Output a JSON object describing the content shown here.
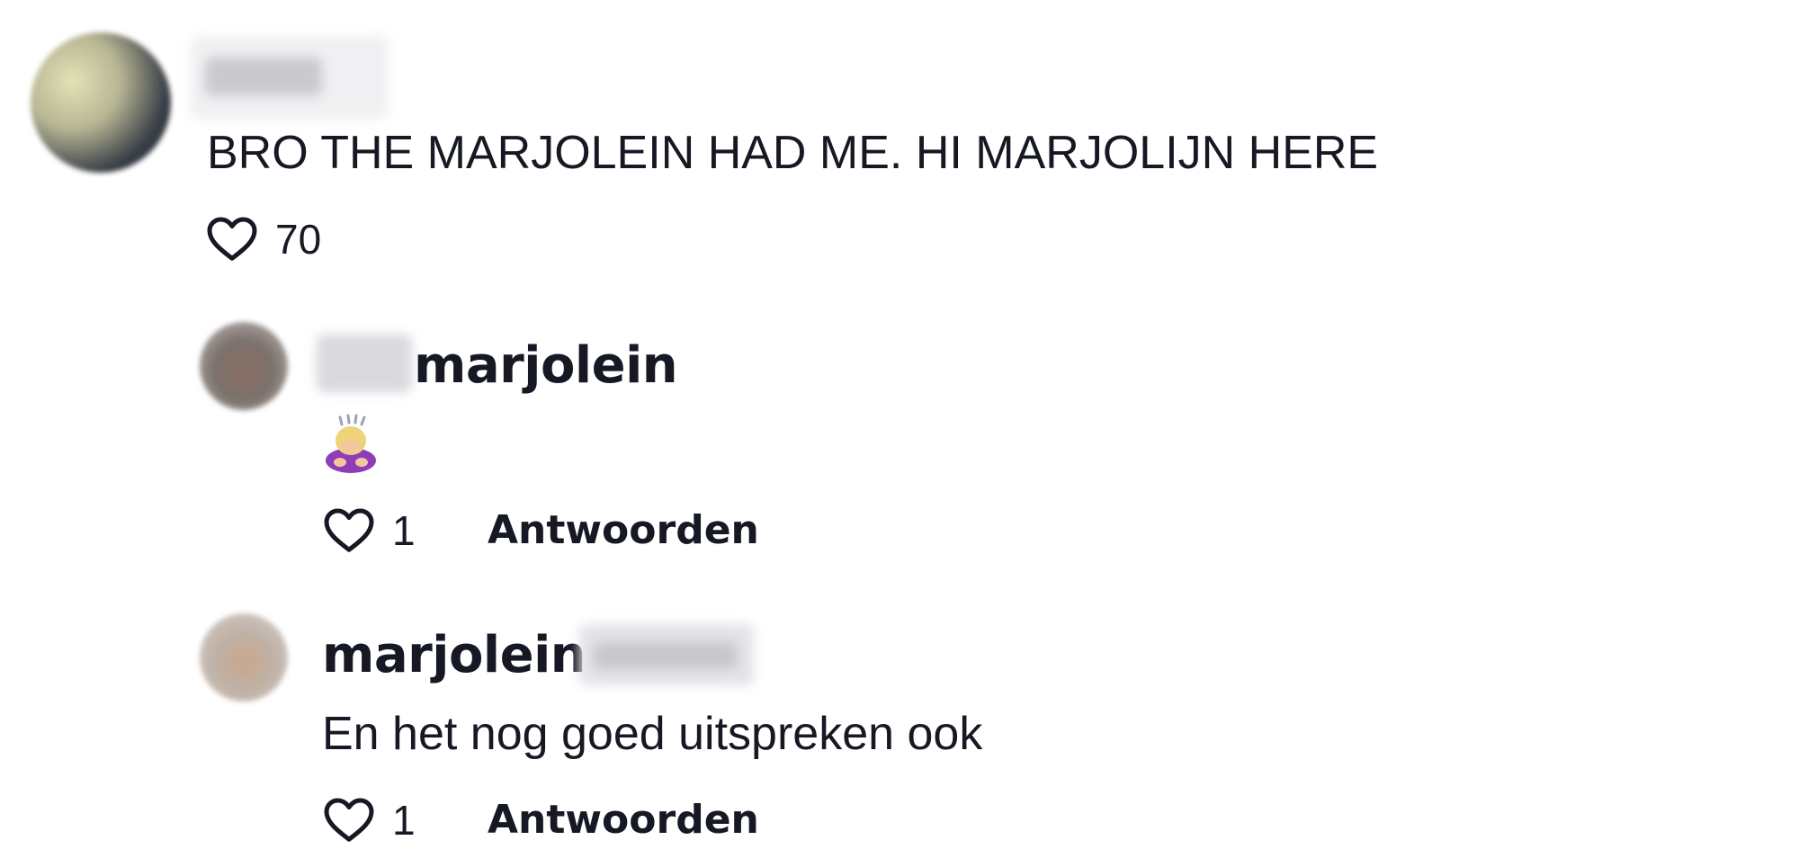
{
  "comments": [
    {
      "username_visible": "",
      "text": "BRO THE MARJOLEIN HAD ME. HI MARJOLIJN HERE",
      "likes": "70"
    }
  ],
  "replies": [
    {
      "username_visible": "marjolein",
      "text_emoji_name": "person-bowing-icon",
      "likes": "1",
      "reply_label": "Antwoorden"
    },
    {
      "username_visible": "marjolein",
      "text": "En het nog goed uitspreken ook",
      "likes": "1",
      "reply_label": "Antwoorden"
    }
  ],
  "colors": {
    "text": "#161823",
    "background": "#ffffff"
  }
}
